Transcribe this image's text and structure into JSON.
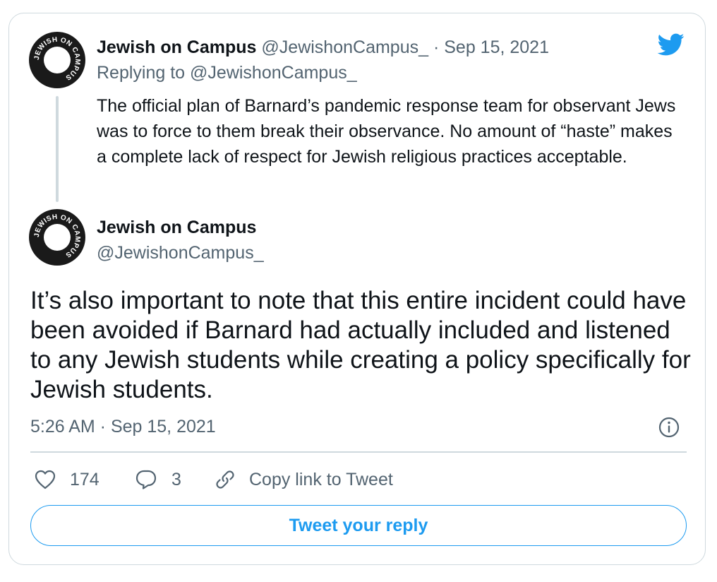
{
  "parent_tweet": {
    "avatar": {
      "text_top": "JEWISH ON CAMPUS",
      "text_bottom": "JEWISH ON CAMPUS"
    },
    "author_name": "Jewish on Campus",
    "handle": "@JewishonCampus_",
    "separator": "·",
    "date": "Sep 15, 2021",
    "replying_to_label": "Replying to",
    "replying_to_handle": "@JewishonCampus_",
    "text": "The official plan of Barnard’s pandemic response team for observant Jews was to force to them break their observance. No amount of “haste” makes a complete lack of respect for Jewish religious practices acceptable."
  },
  "main_tweet": {
    "author_name": "Jewish on Campus",
    "handle": "@JewishonCampus_",
    "text": "It’s also important to note that this entire incident could have been avoided if Barnard had actually included and listened to any Jewish students while creating a policy specifically for Jewish students.",
    "timestamp": "5:26 AM · Sep 15, 2021"
  },
  "actions": {
    "likes": "174",
    "replies": "3",
    "copy_link_label": "Copy link to Tweet"
  },
  "reply_button": {
    "label": "Tweet your reply"
  },
  "icons": {
    "logo": "twitter-bird-icon",
    "info": "info-icon",
    "like": "heart-icon",
    "reply": "speech-bubble-icon",
    "copy": "link-icon"
  },
  "colors": {
    "twitter_blue": "#1d9bf0",
    "text_primary": "#0f1419",
    "text_secondary": "#536471",
    "border": "#cfd9de"
  }
}
